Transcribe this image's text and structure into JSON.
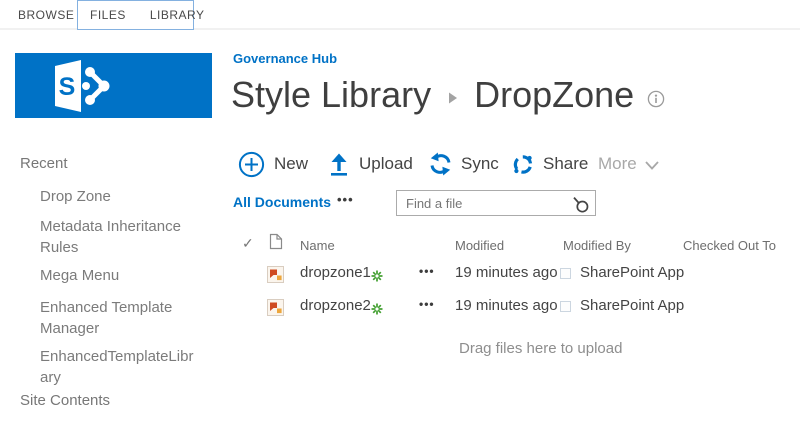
{
  "ribbon": {
    "tabs": [
      {
        "label": "BROWSE"
      },
      {
        "label": "FILES"
      },
      {
        "label": "LIBRARY"
      }
    ]
  },
  "header": {
    "logo_letter": "S",
    "site_link": "Governance Hub",
    "breadcrumb": {
      "parent": "Style Library",
      "current": "DropZone"
    }
  },
  "sidebar": {
    "recent_heading": "Recent",
    "recent_items": [
      "Drop Zone",
      "Metadata Inheritance Rules",
      "Mega Menu",
      "Enhanced Template Manager",
      "EnhancedTemplateLibrary"
    ],
    "site_contents": "Site Contents"
  },
  "toolbar": {
    "commands": [
      {
        "label": "New"
      },
      {
        "label": "Upload"
      },
      {
        "label": "Sync"
      },
      {
        "label": "Share"
      }
    ],
    "more_label": "More"
  },
  "view_bar": {
    "current_view": "All Documents",
    "ellipsis": "•••",
    "search_placeholder": "Find a file"
  },
  "table": {
    "headers": {
      "select_all": "✓",
      "name": "Name",
      "modified": "Modified",
      "modified_by": "Modified By",
      "checked_out_to": "Checked Out To"
    },
    "rows": [
      {
        "name": "dropzone1",
        "is_new": true,
        "ellipsis": "•••",
        "modified": "19 minutes ago",
        "modified_by": "SharePoint App",
        "checked_out_to": ""
      },
      {
        "name": "dropzone2",
        "is_new": true,
        "ellipsis": "•••",
        "modified": "19 minutes ago",
        "modified_by": "SharePoint App",
        "checked_out_to": ""
      }
    ],
    "drag_hint": "Drag files here to upload"
  },
  "colors": {
    "accent": "#0072C6",
    "tab_group_border": "#84b1e0",
    "new_badge_green": "#3f9e2d",
    "text_dark": "#444444",
    "text_gray": "#767676"
  }
}
